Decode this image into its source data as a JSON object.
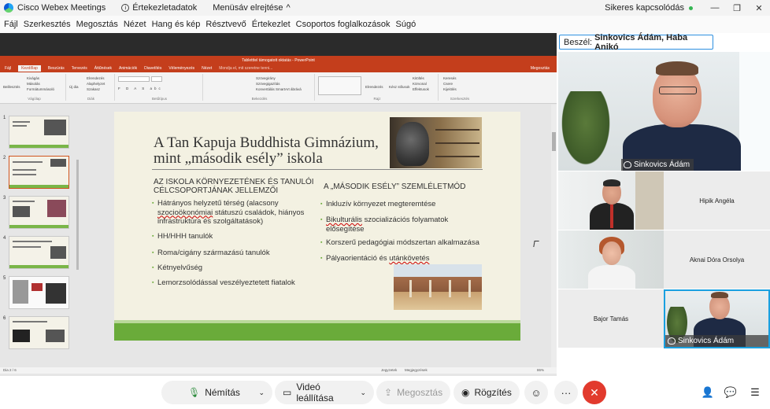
{
  "titlebar": {
    "app_title": "Cisco Webex Meetings",
    "meeting_info": "Értekezletadatok",
    "menu_hide": "Menüsáv elrejtése",
    "menu_hide_chevron": "^",
    "connection_status": "Sikeres kapcsolódás",
    "minimize": "—",
    "restore": "❐",
    "close": "✕"
  },
  "menubar": {
    "items": [
      "Fájl",
      "Szerkesztés",
      "Megosztás",
      "Nézet",
      "Hang és kép",
      "Résztvevő",
      "Értekezlet",
      "Csoportos foglalkozások",
      "Súgó"
    ]
  },
  "ppt": {
    "window_title": "Tabletttel támogatott oktatás - PowerPoint",
    "tabs": [
      "Fájl",
      "Kezdőlap",
      "Beszúrás",
      "Tervezés",
      "Áttűnések",
      "Animációk",
      "Diavetítés",
      "Véleményezés",
      "Nézet",
      "Mondja el, mit szeretne tenni..."
    ],
    "share_label": "Megosztás",
    "ribbon_groups": [
      "Vágólap",
      "Diák",
      "Betűtípus",
      "Bekezdés",
      "Rajz",
      "Szerkesztés"
    ],
    "ribbon_items": {
      "paste": "Beillesztés",
      "cut": "Kivágás",
      "copy": "Másolás",
      "format_painter": "Formátummásoló",
      "new_slide": "Új dia",
      "layout": "Elrendezés",
      "reset": "Alaphelyzet",
      "section": "Szakasz",
      "text_direction": "Szövegirány",
      "align_text": "Szövegigazítás",
      "smartart": "Konvertálás SmartArt ábrává",
      "arrange": "Elrendezés",
      "quick_styles": "Kész stílusok",
      "shape_fill": "Kitöltés",
      "shape_outline": "Körvonal",
      "shape_effects": "Effektusok",
      "find": "Keresés",
      "replace": "Csere",
      "select": "Kijelölés"
    },
    "slide_numbers": [
      "1",
      "2",
      "3",
      "4",
      "5",
      "6"
    ],
    "status_left": "Dia 2 / 6",
    "status_notes": "Jegyzetek",
    "status_comments": "Megjegyzések",
    "zoom": "86%"
  },
  "slide": {
    "title_line1": "A Tan Kapuja Buddhista Gimnázium,",
    "title_line2": "mint „második esély” iskola",
    "left_heading_line1": "AZ ISKOLA KÖRNYEZETÉNEK ÉS TANULÓI",
    "left_heading_line2": "CÉLCSOPORTJÁNAK JELLEMZŐI",
    "right_heading": "A „MÁSODIK ESÉLY” SZEMLÉLETMÓD",
    "left_bullets": [
      {
        "line1": "Hátrányos helyzetű térség (alacsony",
        "line2_a": "szocioökonómiai",
        "line2_b": " státuszú családok, hiányos",
        "line3": "infrastruktúra és szolgáltatások)"
      },
      {
        "line1": "HH/HHH tanulók"
      },
      {
        "line1": "Roma/cigány származású tanulók"
      },
      {
        "line1": "Kétnyelvűség"
      },
      {
        "line1": "Lemorzsolódással veszélyeztetett fiatalok"
      }
    ],
    "right_bullets": [
      {
        "line1": "Inkluzív környezet megteremtése"
      },
      {
        "line1_a": "Bikulturális",
        "line1_b": " szocializációs folyamatok",
        "line2": "elősegítése"
      },
      {
        "line1": "Korszerű pedagógiai módszertan alkalmazása"
      },
      {
        "line1_a": "Pályaorientáció és ",
        "line1_b": "utánkövetés"
      }
    ]
  },
  "speaker": {
    "label": "Beszél:",
    "names": "Sinkovics Ádám, Haba Anikó"
  },
  "participants": {
    "main": "Sinkovics Ádám",
    "hipik": "Hipik Angéla",
    "aknai": "Aknai Dóra Orsolya",
    "bajor": "Bajor Tamás",
    "self": "Sinkovics Ádám"
  },
  "controls": {
    "mute": "Némítás",
    "stop_video": "Videó leállítása",
    "share": "Megosztás",
    "record": "Rögzítés",
    "more": "···",
    "leave": "✕",
    "chevron": "⌄"
  },
  "colors": {
    "ppt_accent": "#c43e1c",
    "slide_green": "#6aab3a",
    "leave_red": "#e23a2d",
    "speaker_border": "#2d8fe0",
    "self_border": "#19a0e0",
    "connection_green": "#34b552"
  },
  "icons": {
    "mute": "microphone-icon",
    "video": "video-camera-icon",
    "share": "share-screen-icon",
    "record": "record-icon",
    "emoji": "emoji-icon",
    "more": "more-icon",
    "leave": "leave-icon",
    "participants": "participants-icon",
    "chat": "chat-icon",
    "menu": "menu-icon"
  }
}
